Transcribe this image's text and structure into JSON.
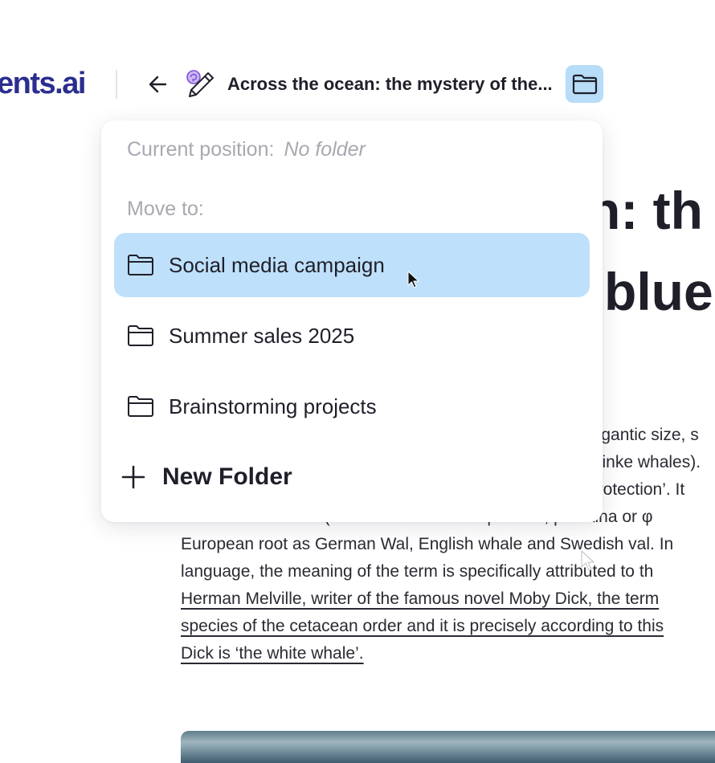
{
  "header": {
    "brand": "ents.ai",
    "back_icon": "arrow-left-icon",
    "doc_icon": "pencil-ai-icon",
    "doc_title": "Across the ocean: the mystery of the...",
    "folder_icon": "folder-icon"
  },
  "article": {
    "heading_line1": "n: th",
    "heading_line2": "blue",
    "lines": [
      {
        "text": "gigantic size, s",
        "partial": true
      },
      {
        "text": "minke whales).",
        "partial": true
      },
      {
        "text": "protection’. It",
        "partial": true
      },
      {
        "text": "balloena or balena (from Ancient Greek: φάλαινα, phálaina or φ",
        "partial": false
      },
      {
        "text": "European root as German Wal, English whale and Swedish val. In",
        "partial": false
      },
      {
        "text": "language, the meaning of the term is specifically attributed to th",
        "partial": false
      },
      {
        "text": "Herman Melville, writer of the famous novel Moby Dick, the term",
        "partial": false,
        "underline": true
      },
      {
        "text": "species of the cetacean order and it is precisely according to this",
        "partial": false,
        "underline": true
      },
      {
        "text": "Dick is ‘the white whale’.",
        "partial": false,
        "underline": true
      }
    ]
  },
  "popup": {
    "current_position_label": "Current position:",
    "current_position_value": "No folder",
    "move_to_label": "Move to:",
    "folders": [
      {
        "label": "Social media campaign",
        "active": true
      },
      {
        "label": "Summer sales 2025",
        "active": false
      },
      {
        "label": "Brainstorming projects",
        "active": false
      }
    ],
    "new_folder_label": "New Folder"
  },
  "colors": {
    "brand": "#2b2e8f",
    "highlight": "#bfe0fa",
    "folder_button_bg": "#b7ddf8",
    "muted_text": "#a8a8b0"
  }
}
